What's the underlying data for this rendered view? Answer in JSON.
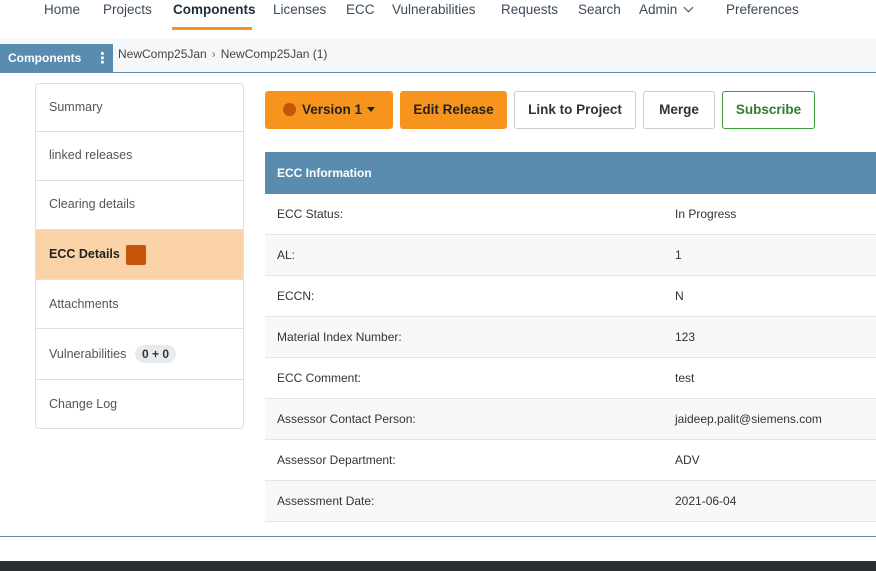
{
  "nav": {
    "items": [
      "Home",
      "Projects",
      "Components",
      "Licenses",
      "ECC",
      "Vulnerabilities",
      "Requests",
      "Search",
      "Admin",
      "Preferences"
    ],
    "active": "Components",
    "accent": "#f7941d"
  },
  "breadcrumb": {
    "section": "Components",
    "items": [
      "NewComp25Jan",
      "NewComp25Jan (1)"
    ]
  },
  "sidebar": {
    "items": [
      {
        "label": "Summary"
      },
      {
        "label": "linked releases"
      },
      {
        "label": "Clearing details"
      },
      {
        "label": "ECC Details"
      },
      {
        "label": "Attachments"
      },
      {
        "label": "Vulnerabilities",
        "badge": "0 + 0"
      },
      {
        "label": "Change Log"
      }
    ],
    "active": "ECC Details"
  },
  "toolbar": {
    "version_label": "Version 1",
    "edit_label": "Edit Release",
    "link_label": "Link to Project",
    "merge_label": "Merge",
    "subscribe_label": "Subscribe"
  },
  "ecc": {
    "title": "ECC Information",
    "rows": [
      {
        "key": "ECC Status:",
        "value": "In Progress"
      },
      {
        "key": "AL:",
        "value": "1"
      },
      {
        "key": "ECCN:",
        "value": "N"
      },
      {
        "key": "Material Index Number:",
        "value": "123"
      },
      {
        "key": "ECC Comment:",
        "value": "test"
      },
      {
        "key": "Assessor Contact Person:",
        "value": "jaideep.palit@siemens.com"
      },
      {
        "key": "Assessor Department:",
        "value": "ADV"
      },
      {
        "key": "Assessment Date:",
        "value": "2021-06-04"
      }
    ]
  },
  "colors": {
    "header_blue": "#5a8cb0",
    "orange": "#f7941d",
    "status_dot": "#c5530a",
    "active_sidebar": "#f9d2a8"
  }
}
